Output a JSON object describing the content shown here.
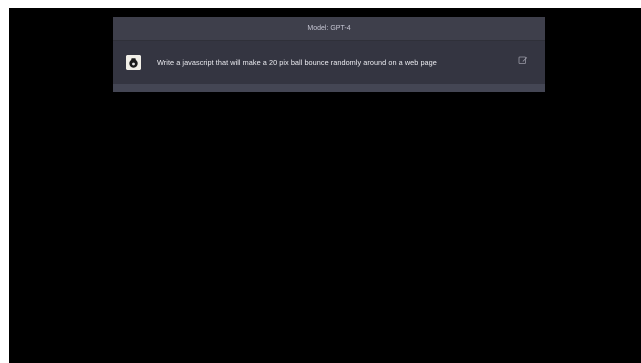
{
  "header": {
    "model_label": "Model: GPT-4"
  },
  "conversation": {
    "user_message": {
      "avatar_icon": "user-avatar-icon",
      "text": "Write a javascript that will make a 20 pix ball bounce randomly around on a web page",
      "edit_icon": "edit-icon"
    }
  },
  "colors": {
    "screen_bg": "#000000",
    "panel_bg": "#343541",
    "header_bg": "#3e3f4b",
    "text": "#ececf1",
    "muted_text": "#c5c5d2"
  }
}
